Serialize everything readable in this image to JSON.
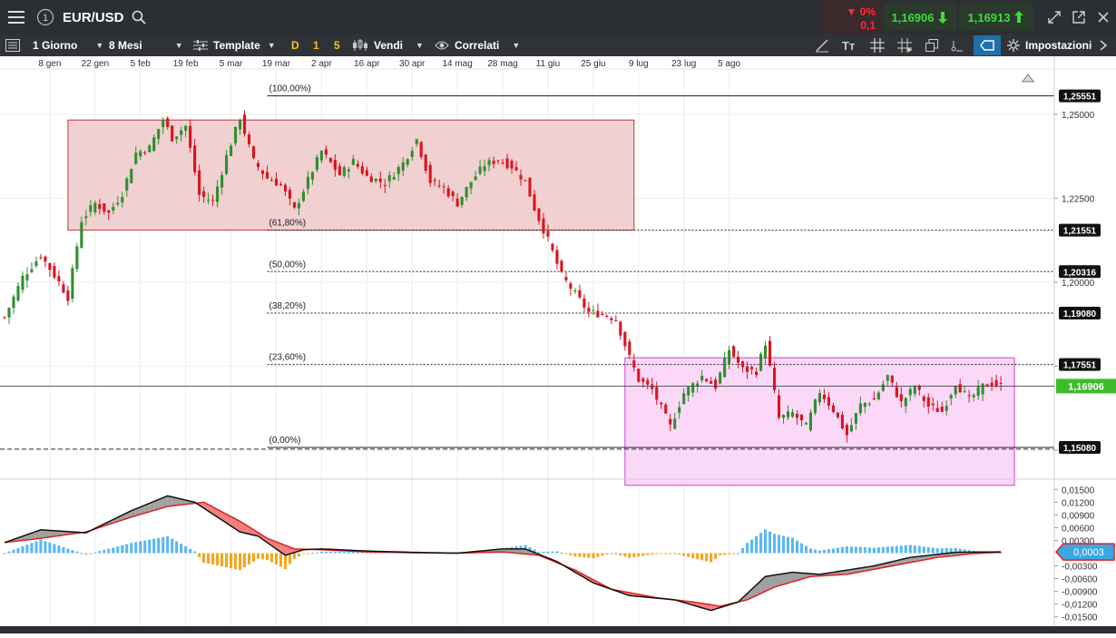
{
  "header": {
    "menu_icon": "hamburger-menu-icon",
    "info_icon": "info-circle-icon",
    "symbol": "EUR/USD",
    "change_pct": "0%",
    "change_abs": "0,1",
    "sell_price": "1,16906",
    "buy_price": "1,16913",
    "colors": {
      "down": "#e8202e",
      "sell": "#2ea043",
      "buy": "#2ea043"
    }
  },
  "toolbar": {
    "interval": "1 Giorno",
    "period": "8 Mesi",
    "template": "Template",
    "d": "D",
    "one": "1",
    "five": "5",
    "sell": "Vendi",
    "correlati": "Correlati",
    "settings": "Impostazioni"
  },
  "chart_data": [
    {
      "type": "candlestick",
      "x_tick_labels": [
        "8 gen",
        "22 gen",
        "5 feb",
        "19 feb",
        "5 mar",
        "19 mar",
        "2 apr",
        "16 apr",
        "30 apr",
        "14 mag",
        "28 mag",
        "11 giu",
        "25 giu",
        "9 lug",
        "23 lug",
        "5 ago"
      ],
      "y_tick_labels": [
        "1,25000",
        "1,22500",
        "1,20000",
        "1,17500",
        "1,15000"
      ],
      "ylim": [
        1.1435,
        1.2635
      ],
      "last_price": "1,16906",
      "price_labels": [
        "1,25551",
        "1,21551",
        "1,20316",
        "1,19080",
        "1,17551",
        "1,15080"
      ],
      "fibonacci": {
        "levels": [
          {
            "label": "(100,00%)",
            "value": 1.25551
          },
          {
            "label": "(61,80%)",
            "value": 1.21551
          },
          {
            "label": "(50,00%)",
            "value": 1.20316
          },
          {
            "label": "(38,20%)",
            "value": 1.1908
          },
          {
            "label": "(23,60%)",
            "value": 1.17551
          },
          {
            "label": "(0,00%)",
            "value": 1.1508
          }
        ]
      },
      "zones": [
        {
          "name": "range-1",
          "start_index": 14,
          "end_index": 139,
          "low": 1.2155,
          "high": 1.2483,
          "color": "#f0d0d0"
        },
        {
          "name": "range-2",
          "start_index": 137,
          "end_index": 223,
          "low": 1.1395,
          "high": 1.1775,
          "color": "#fbd8f8"
        }
      ],
      "close_anchors": [
        [
          0,
          1.1895
        ],
        [
          4,
          1.2015
        ],
        [
          8,
          1.208
        ],
        [
          12,
          1.2
        ],
        [
          14,
          1.1955
        ],
        [
          17,
          1.2185
        ],
        [
          20,
          1.2235
        ],
        [
          23,
          1.2205
        ],
        [
          26,
          1.2265
        ],
        [
          29,
          1.2385
        ],
        [
          32,
          1.24
        ],
        [
          35,
          1.2485
        ],
        [
          37,
          1.243
        ],
        [
          40,
          1.2465
        ],
        [
          43,
          1.226
        ],
        [
          46,
          1.224
        ],
        [
          49,
          1.2375
        ],
        [
          52,
          1.249
        ],
        [
          55,
          1.236
        ],
        [
          58,
          1.231
        ],
        [
          61,
          1.229
        ],
        [
          64,
          1.2215
        ],
        [
          66,
          1.2275
        ],
        [
          70,
          1.239
        ],
        [
          74,
          1.232
        ],
        [
          77,
          1.236
        ],
        [
          80,
          1.2315
        ],
        [
          84,
          1.2295
        ],
        [
          88,
          1.2355
        ],
        [
          91,
          1.2425
        ],
        [
          94,
          1.23
        ],
        [
          97,
          1.228
        ],
        [
          100,
          1.2235
        ],
        [
          103,
          1.23
        ],
        [
          106,
          1.235
        ],
        [
          109,
          1.2365
        ],
        [
          112,
          1.2345
        ],
        [
          115,
          1.23
        ],
        [
          117,
          1.222
        ],
        [
          120,
          1.2125
        ],
        [
          123,
          1.202
        ],
        [
          126,
          1.1965
        ],
        [
          129,
          1.191
        ],
        [
          132,
          1.1905
        ],
        [
          135,
          1.189
        ],
        [
          138,
          1.1775
        ],
        [
          140,
          1.171
        ],
        [
          143,
          1.168
        ],
        [
          147,
          1.157
        ],
        [
          150,
          1.167
        ],
        [
          154,
          1.172
        ],
        [
          157,
          1.169
        ],
        [
          160,
          1.18
        ],
        [
          163,
          1.174
        ],
        [
          166,
          1.1735
        ],
        [
          168,
          1.182
        ],
        [
          171,
          1.1595
        ],
        [
          174,
          1.161
        ],
        [
          177,
          1.157
        ],
        [
          180,
          1.1675
        ],
        [
          183,
          1.162
        ],
        [
          186,
          1.1545
        ],
        [
          189,
          1.1635
        ],
        [
          192,
          1.165
        ],
        [
          195,
          1.172
        ],
        [
          198,
          1.164
        ],
        [
          201,
          1.169
        ],
        [
          204,
          1.163
        ],
        [
          207,
          1.1615
        ],
        [
          210,
          1.17
        ],
        [
          213,
          1.165
        ],
        [
          216,
          1.169
        ],
        [
          218,
          1.17
        ],
        [
          220,
          1.169
        ]
      ]
    },
    {
      "type": "macd",
      "y_tick_labels": [
        "0,01500",
        "0,01200",
        "0,00900",
        "0,00600",
        "0,00300",
        "0,0003",
        "-0,00300",
        "-0,00600",
        "-0,00900",
        "-0,01200",
        "-0,01500"
      ],
      "ylim": [
        -0.0155,
        0.017
      ],
      "last_value": "0,0003",
      "macd_anchors": [
        [
          0,
          0.0025
        ],
        [
          8,
          0.0055
        ],
        [
          18,
          0.0048
        ],
        [
          28,
          0.01
        ],
        [
          36,
          0.0135
        ],
        [
          42,
          0.012
        ],
        [
          52,
          0.005
        ],
        [
          56,
          0.004
        ],
        [
          62,
          -0.0005
        ],
        [
          66,
          0.0008
        ],
        [
          70,
          0.001
        ],
        [
          80,
          0.0005
        ],
        [
          90,
          0.0002
        ],
        [
          100,
          0.0
        ],
        [
          110,
          0.001
        ],
        [
          115,
          0.001
        ],
        [
          122,
          -0.002
        ],
        [
          130,
          -0.007
        ],
        [
          138,
          -0.01
        ],
        [
          148,
          -0.011
        ],
        [
          156,
          -0.0135
        ],
        [
          162,
          -0.0115
        ],
        [
          168,
          -0.0055
        ],
        [
          174,
          -0.0045
        ],
        [
          180,
          -0.005
        ],
        [
          186,
          -0.004
        ],
        [
          192,
          -0.003
        ],
        [
          200,
          -0.001
        ],
        [
          210,
          0.0002
        ],
        [
          220,
          0.0003
        ]
      ],
      "signal_anchors": [
        [
          0,
          0.0025
        ],
        [
          8,
          0.0035
        ],
        [
          18,
          0.005
        ],
        [
          28,
          0.0085
        ],
        [
          36,
          0.011
        ],
        [
          44,
          0.012
        ],
        [
          52,
          0.0075
        ],
        [
          58,
          0.0035
        ],
        [
          64,
          0.001
        ],
        [
          70,
          0.0008
        ],
        [
          80,
          0.0003
        ],
        [
          90,
          0.0001
        ],
        [
          100,
          0.0
        ],
        [
          110,
          0.0003
        ],
        [
          118,
          -0.0005
        ],
        [
          126,
          -0.004
        ],
        [
          134,
          -0.0085
        ],
        [
          144,
          -0.0105
        ],
        [
          152,
          -0.0115
        ],
        [
          158,
          -0.0125
        ],
        [
          164,
          -0.011
        ],
        [
          170,
          -0.008
        ],
        [
          178,
          -0.0055
        ],
        [
          186,
          -0.005
        ],
        [
          196,
          -0.003
        ],
        [
          206,
          -0.001
        ],
        [
          214,
          -0.0001
        ],
        [
          220,
          0.0002
        ]
      ],
      "colors": {
        "hist_pos": "#5bb8f0",
        "hist_neg": "#f5a623",
        "fill_pos": "#a0a0a0",
        "fill_neg": "#f08080",
        "signal": "#e02020",
        "macd": "#111111"
      }
    }
  ]
}
